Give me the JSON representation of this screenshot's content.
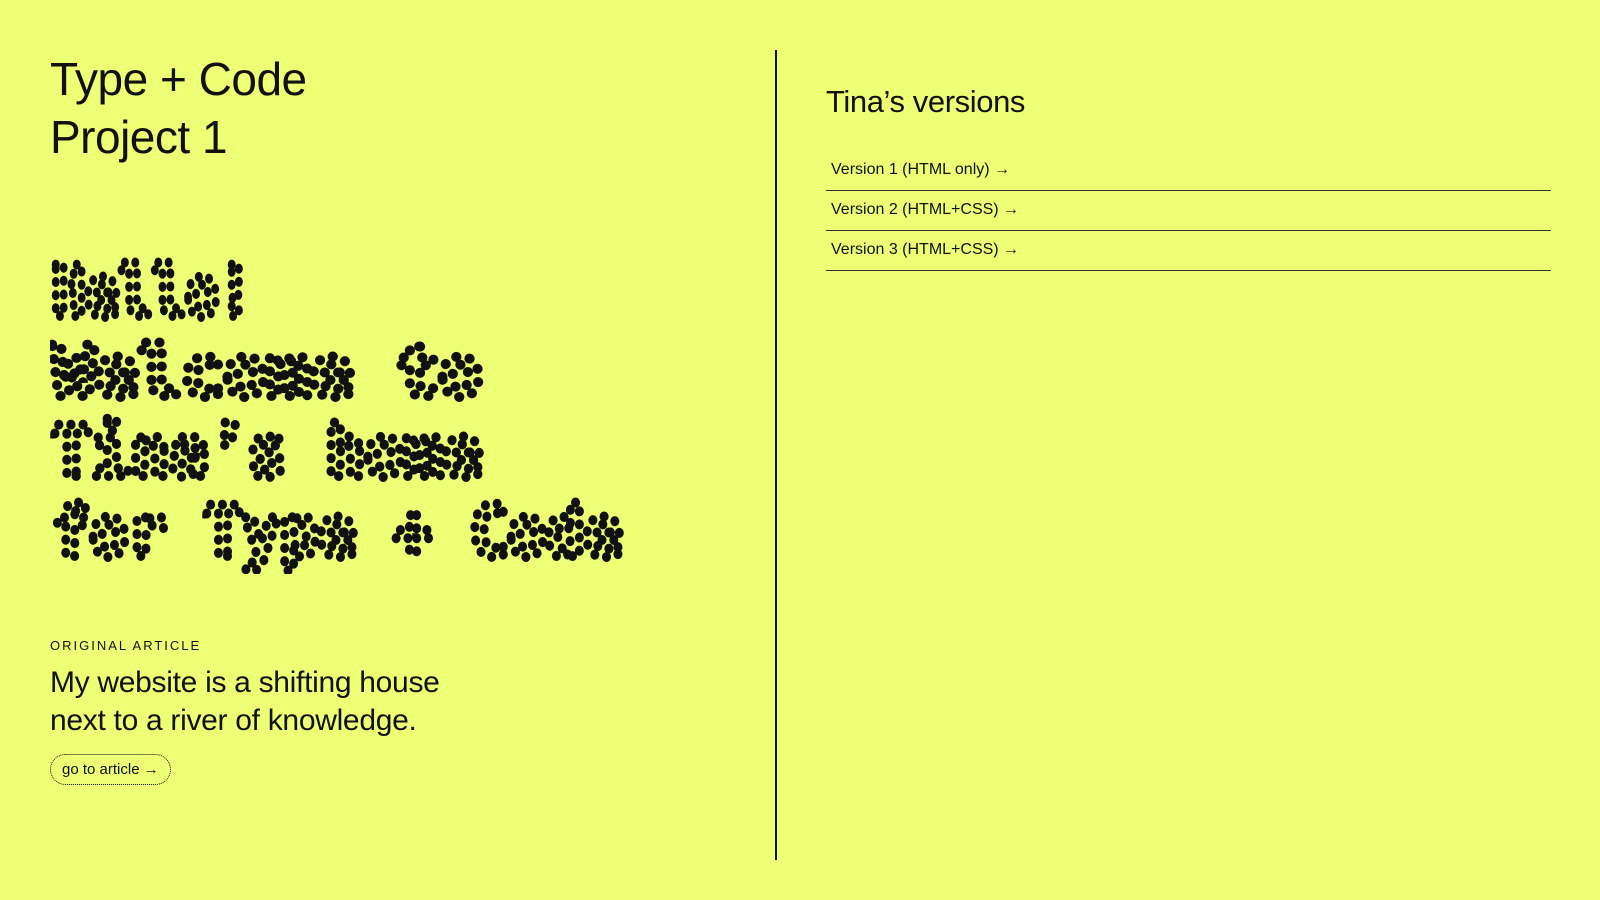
{
  "header": {
    "title_line1": "Type + Code",
    "title_line2": "Project 1"
  },
  "hero": {
    "line1": "Hello!",
    "line2": "Welcome to",
    "line3": "Tina’s home",
    "line4": "for Type + Code"
  },
  "article": {
    "eyebrow": "ORIGINAL ARTICLE",
    "title_line1": "My website is a shifting house",
    "title_line2": "next to a river of knowledge.",
    "button_label": "go to article →"
  },
  "versions": {
    "title": "Tina’s versions",
    "items": [
      {
        "label": "Version 1 (HTML only) →"
      },
      {
        "label": "Version 2 (HTML+CSS) →"
      },
      {
        "label": "Version 3 (HTML+CSS) →"
      }
    ]
  },
  "colors": {
    "background": "#ecff75",
    "text": "#111111"
  }
}
